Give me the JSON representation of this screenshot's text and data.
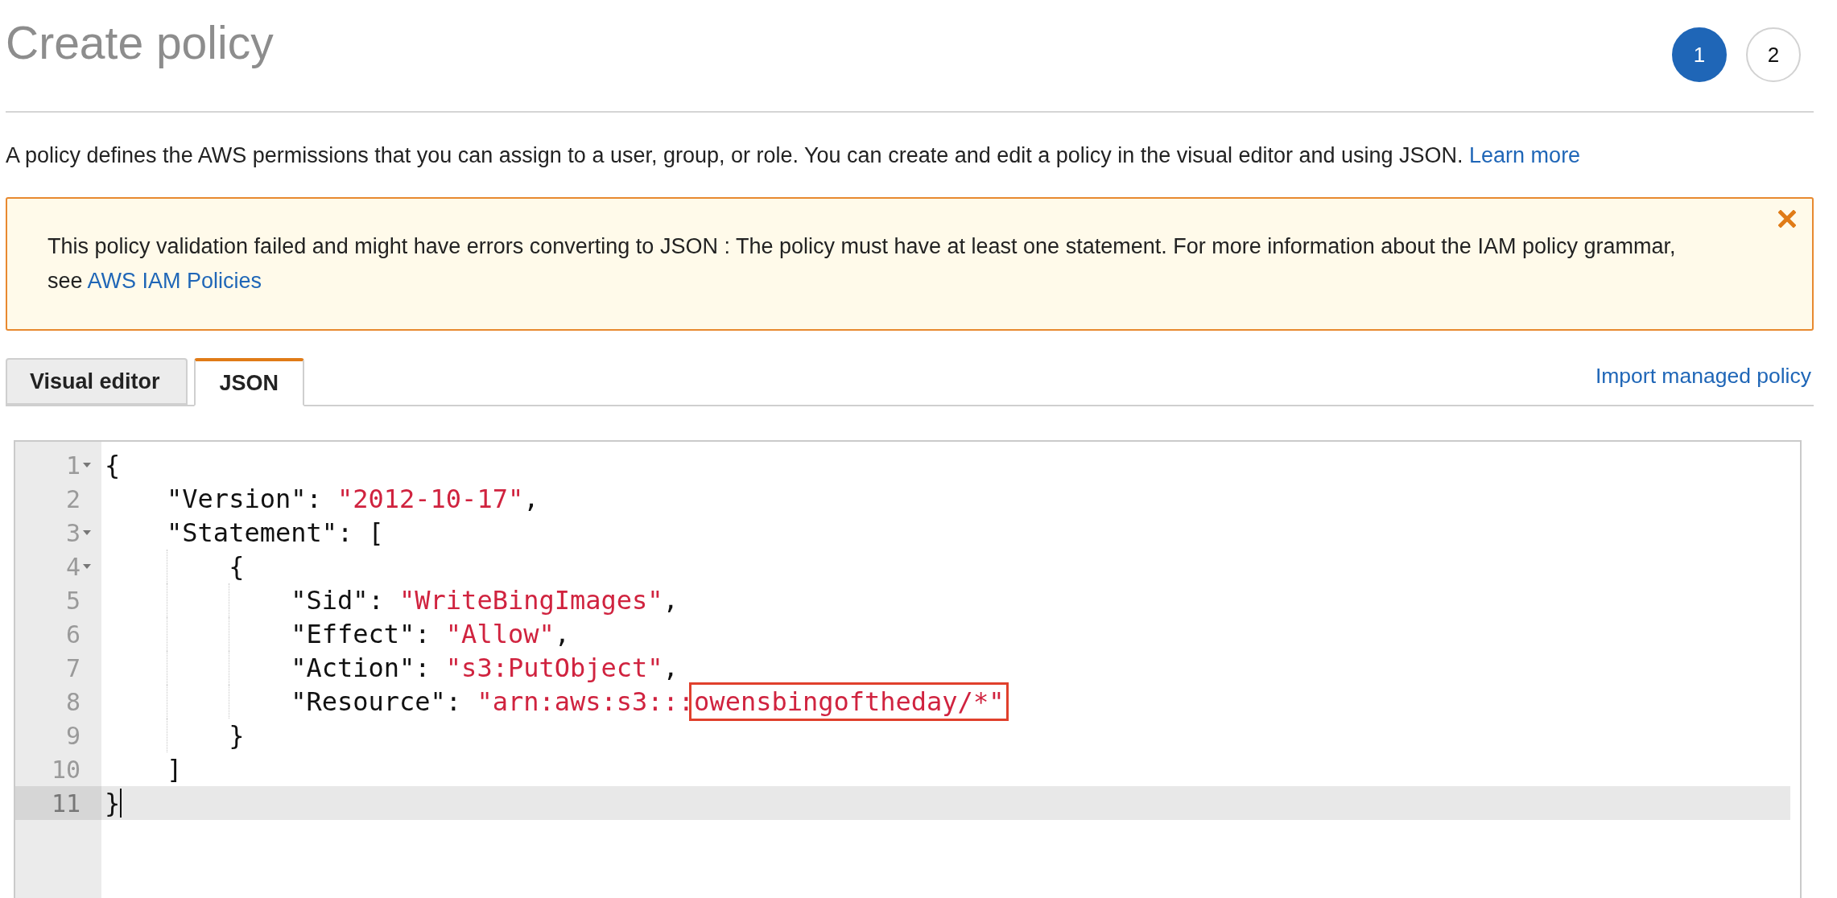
{
  "header": {
    "title": "Create policy",
    "steps": [
      {
        "label": "1",
        "selected": true
      },
      {
        "label": "2",
        "selected": false
      }
    ]
  },
  "description": {
    "text": "A policy defines the AWS permissions that you can assign to a user, group, or role. You can create and edit a policy in the visual editor and using JSON.",
    "link": "Learn more"
  },
  "alert": {
    "text": "This policy validation failed and might have errors converting to JSON : The policy must have at least one statement. For more information about the IAM policy grammar, see",
    "link": "AWS IAM Policies"
  },
  "tabs": [
    {
      "label": "Visual editor",
      "selected": false
    },
    {
      "label": "JSON",
      "selected": true
    }
  ],
  "import_link": "Import managed policy",
  "editor": {
    "lines": [
      {
        "number": "1",
        "foldable": true,
        "active": false,
        "tokens": [
          {
            "kind": "punct",
            "text": "{"
          }
        ]
      },
      {
        "number": "2",
        "foldable": false,
        "active": false,
        "tokens": [
          {
            "kind": "key",
            "text": "    \"Version\""
          },
          {
            "kind": "punct",
            "text": ": "
          },
          {
            "kind": "string",
            "text": "\"2012-10-17\""
          },
          {
            "kind": "punct",
            "text": ","
          }
        ]
      },
      {
        "number": "3",
        "foldable": true,
        "active": false,
        "tokens": [
          {
            "kind": "key",
            "text": "    \"Statement\""
          },
          {
            "kind": "punct",
            "text": ": ["
          }
        ]
      },
      {
        "number": "4",
        "foldable": true,
        "active": false,
        "tokens": [
          {
            "kind": "punct",
            "text": "        {"
          }
        ]
      },
      {
        "number": "5",
        "foldable": false,
        "active": false,
        "tokens": [
          {
            "kind": "key",
            "text": "            \"Sid\""
          },
          {
            "kind": "punct",
            "text": ": "
          },
          {
            "kind": "string",
            "text": "\"WriteBingImages\""
          },
          {
            "kind": "punct",
            "text": ","
          }
        ]
      },
      {
        "number": "6",
        "foldable": false,
        "active": false,
        "tokens": [
          {
            "kind": "key",
            "text": "            \"Effect\""
          },
          {
            "kind": "punct",
            "text": ": "
          },
          {
            "kind": "string",
            "text": "\"Allow\""
          },
          {
            "kind": "punct",
            "text": ","
          }
        ]
      },
      {
        "number": "7",
        "foldable": false,
        "active": false,
        "tokens": [
          {
            "kind": "key",
            "text": "            \"Action\""
          },
          {
            "kind": "punct",
            "text": ": "
          },
          {
            "kind": "string",
            "text": "\"s3:PutObject\""
          },
          {
            "kind": "punct",
            "text": ","
          }
        ]
      },
      {
        "number": "8",
        "foldable": false,
        "active": false,
        "tokens": [
          {
            "kind": "key",
            "text": "            \"Resource\""
          },
          {
            "kind": "punct",
            "text": ": "
          },
          {
            "kind": "string",
            "text": "\"arn:aws:s3:::"
          },
          {
            "kind": "string",
            "text": "owensbingoftheday/*\"",
            "highlighted": true
          }
        ]
      },
      {
        "number": "9",
        "foldable": false,
        "active": false,
        "tokens": [
          {
            "kind": "punct",
            "text": "        }"
          }
        ]
      },
      {
        "number": "10",
        "foldable": false,
        "active": false,
        "tokens": [
          {
            "kind": "punct",
            "text": "    ]"
          }
        ]
      },
      {
        "number": "11",
        "foldable": false,
        "active": true,
        "tokens": [
          {
            "kind": "punct",
            "text": "}"
          }
        ]
      }
    ]
  }
}
